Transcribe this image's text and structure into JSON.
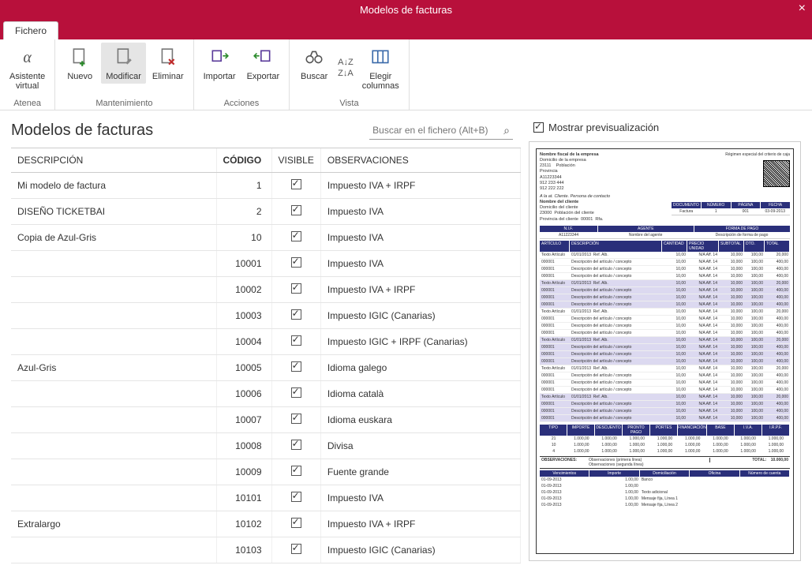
{
  "window": {
    "title": "Modelos de facturas"
  },
  "tabs": {
    "fichero": "Fichero"
  },
  "ribbon": {
    "atenea": {
      "asistente": "Asistente\nvirtual",
      "group": "Atenea"
    },
    "mant": {
      "nuevo": "Nuevo",
      "modificar": "Modificar",
      "eliminar": "Eliminar",
      "group": "Mantenimiento"
    },
    "acc": {
      "importar": "Importar",
      "exportar": "Exportar",
      "group": "Acciones"
    },
    "vista": {
      "buscar": "Buscar",
      "elegir": "Elegir\ncolumnas",
      "group": "Vista"
    }
  },
  "left_title": "Modelos de facturas",
  "search_placeholder": "Buscar en el fichero (Alt+B)",
  "columns": {
    "desc": "DESCRIPCIÓN",
    "codigo": "CÓDIGO",
    "visible": "VISIBLE",
    "obs": "OBSERVACIONES"
  },
  "rows": [
    {
      "desc": "Mi modelo de factura",
      "codigo": "1",
      "visible": true,
      "obs": "Impuesto IVA + IRPF"
    },
    {
      "desc": "DISEÑO TICKETBAI",
      "codigo": "2",
      "visible": true,
      "obs": "Impuesto IVA"
    },
    {
      "desc": "Copia de Azul-Gris",
      "codigo": "10",
      "visible": true,
      "obs": "Impuesto IVA"
    },
    {
      "desc": "",
      "codigo": "10001",
      "visible": true,
      "obs": "Impuesto IVA",
      "group_start": "Azul-Gris"
    },
    {
      "desc": "",
      "codigo": "10002",
      "visible": true,
      "obs": "Impuesto IVA + IRPF"
    },
    {
      "desc": "",
      "codigo": "10003",
      "visible": true,
      "obs": "Impuesto IGIC (Canarias)"
    },
    {
      "desc": "",
      "codigo": "10004",
      "visible": true,
      "obs": "Impuesto IGIC + IRPF (Canarias)"
    },
    {
      "desc": "Azul-Gris",
      "codigo": "10005",
      "visible": true,
      "obs": "Idioma galego"
    },
    {
      "desc": "",
      "codigo": "10006",
      "visible": true,
      "obs": "Idioma català"
    },
    {
      "desc": "",
      "codigo": "10007",
      "visible": true,
      "obs": "Idioma euskara"
    },
    {
      "desc": "",
      "codigo": "10008",
      "visible": true,
      "obs": "Divisa"
    },
    {
      "desc": "",
      "codigo": "10009",
      "visible": true,
      "obs": "Fuente grande"
    },
    {
      "desc": "",
      "codigo": "10101",
      "visible": true,
      "obs": "Impuesto IVA"
    },
    {
      "desc": "Extralargo",
      "codigo": "10102",
      "visible": true,
      "obs": "Impuesto IVA + IRPF"
    },
    {
      "desc": "",
      "codigo": "10103",
      "visible": true,
      "obs": "Impuesto IGIC (Canarias)"
    }
  ],
  "preview_label": "Mostrar previsualización",
  "invoice": {
    "regimen": "Régimen especial del criterio de caja",
    "company": {
      "name": "Nombre fiscal de la empresa",
      "addr": "Domicilio de la empresa",
      "cp": "23111",
      "pob": "Población",
      "prov": "Provincia",
      "nif": "A11223344",
      "tel1": "912 233 444",
      "tel2": "912 222 222"
    },
    "client": {
      "att": "A la at. Cliente. Persona de contacto",
      "name": "Nombre del cliente",
      "addr": "Domicilio del cliente",
      "cp": "23000",
      "pob": "Población del cliente",
      "prov": "Provincia del cliente",
      "cod": "00001",
      "rfa": "Rfa."
    },
    "doc": {
      "h1": "DOCUMENTO",
      "h2": "NÚMERO",
      "h3": "PÁGINA",
      "h4": "FECHA",
      "v1": "Factura",
      "v2": "1",
      "v3": "001",
      "v4": "03-09-2013"
    },
    "nif_agente": {
      "h1": "N.I.F.",
      "h2": "AGENTE",
      "h3": "FORMA DE PAGO",
      "v1": "A11223344",
      "v2": "Nombre del agente",
      "v3": "Descripción de forma de pago"
    },
    "line_headers": [
      "ARTÍCULO",
      "DESCRIPCIÓN",
      "CANTIDAD",
      "PRECIO UNIDAD",
      "SUBTOTAL",
      "DTO.",
      "TOTAL"
    ],
    "lines_pattern": {
      "art1": "Texto Artículo",
      "fecha": "01/01/2013",
      "ref": "Ref. Alb.",
      "cant": "10,00",
      "precio": "N/A Aff. 14",
      "sub": "10,000",
      "dto": "100,00",
      "tot": "20,000",
      "d2": "Descripción del artículo / concepto",
      "imp": "400,00"
    },
    "totals_headers": [
      "TIPO",
      "IMPORTE",
      "DESCUENTO",
      "PRONTO PAGO",
      "PORTES",
      "FINANCIACIÓN",
      "BASE",
      "I.V.A.",
      "I.R.P.F."
    ],
    "totals_rows": [
      {
        "tipo": "21",
        "v": "1.000,00"
      },
      {
        "tipo": "10",
        "v": "1.000,00"
      },
      {
        "tipo": "4",
        "v": "1.000,00"
      }
    ],
    "obs_label": "OBSERVACIONES:",
    "obs1": "Observaciones (primera línea)",
    "obs2": "Observaciones (segunda línea)",
    "total_label": "TOTAL:",
    "total_value": "10.000,00",
    "venc_headers": [
      "Vencimientos",
      "Importe",
      "Domiciliación",
      "Oficina",
      "Número de cuenta"
    ],
    "venc_rows": [
      {
        "f": "01-09-2013",
        "i": "1.00,00",
        "d": "Banco"
      },
      {
        "f": "01-09-2013",
        "i": "1.00,00",
        "d": ""
      },
      {
        "f": "01-09-2013",
        "i": "1.00,00",
        "d": "Texto adicional"
      },
      {
        "f": "01-09-2013",
        "i": "1.00,00",
        "d": "Mensaje fija, Línea 1"
      },
      {
        "f": "01-09-2013",
        "i": "1.00,00",
        "d": "Mensaje fija, Línea 2"
      }
    ]
  }
}
